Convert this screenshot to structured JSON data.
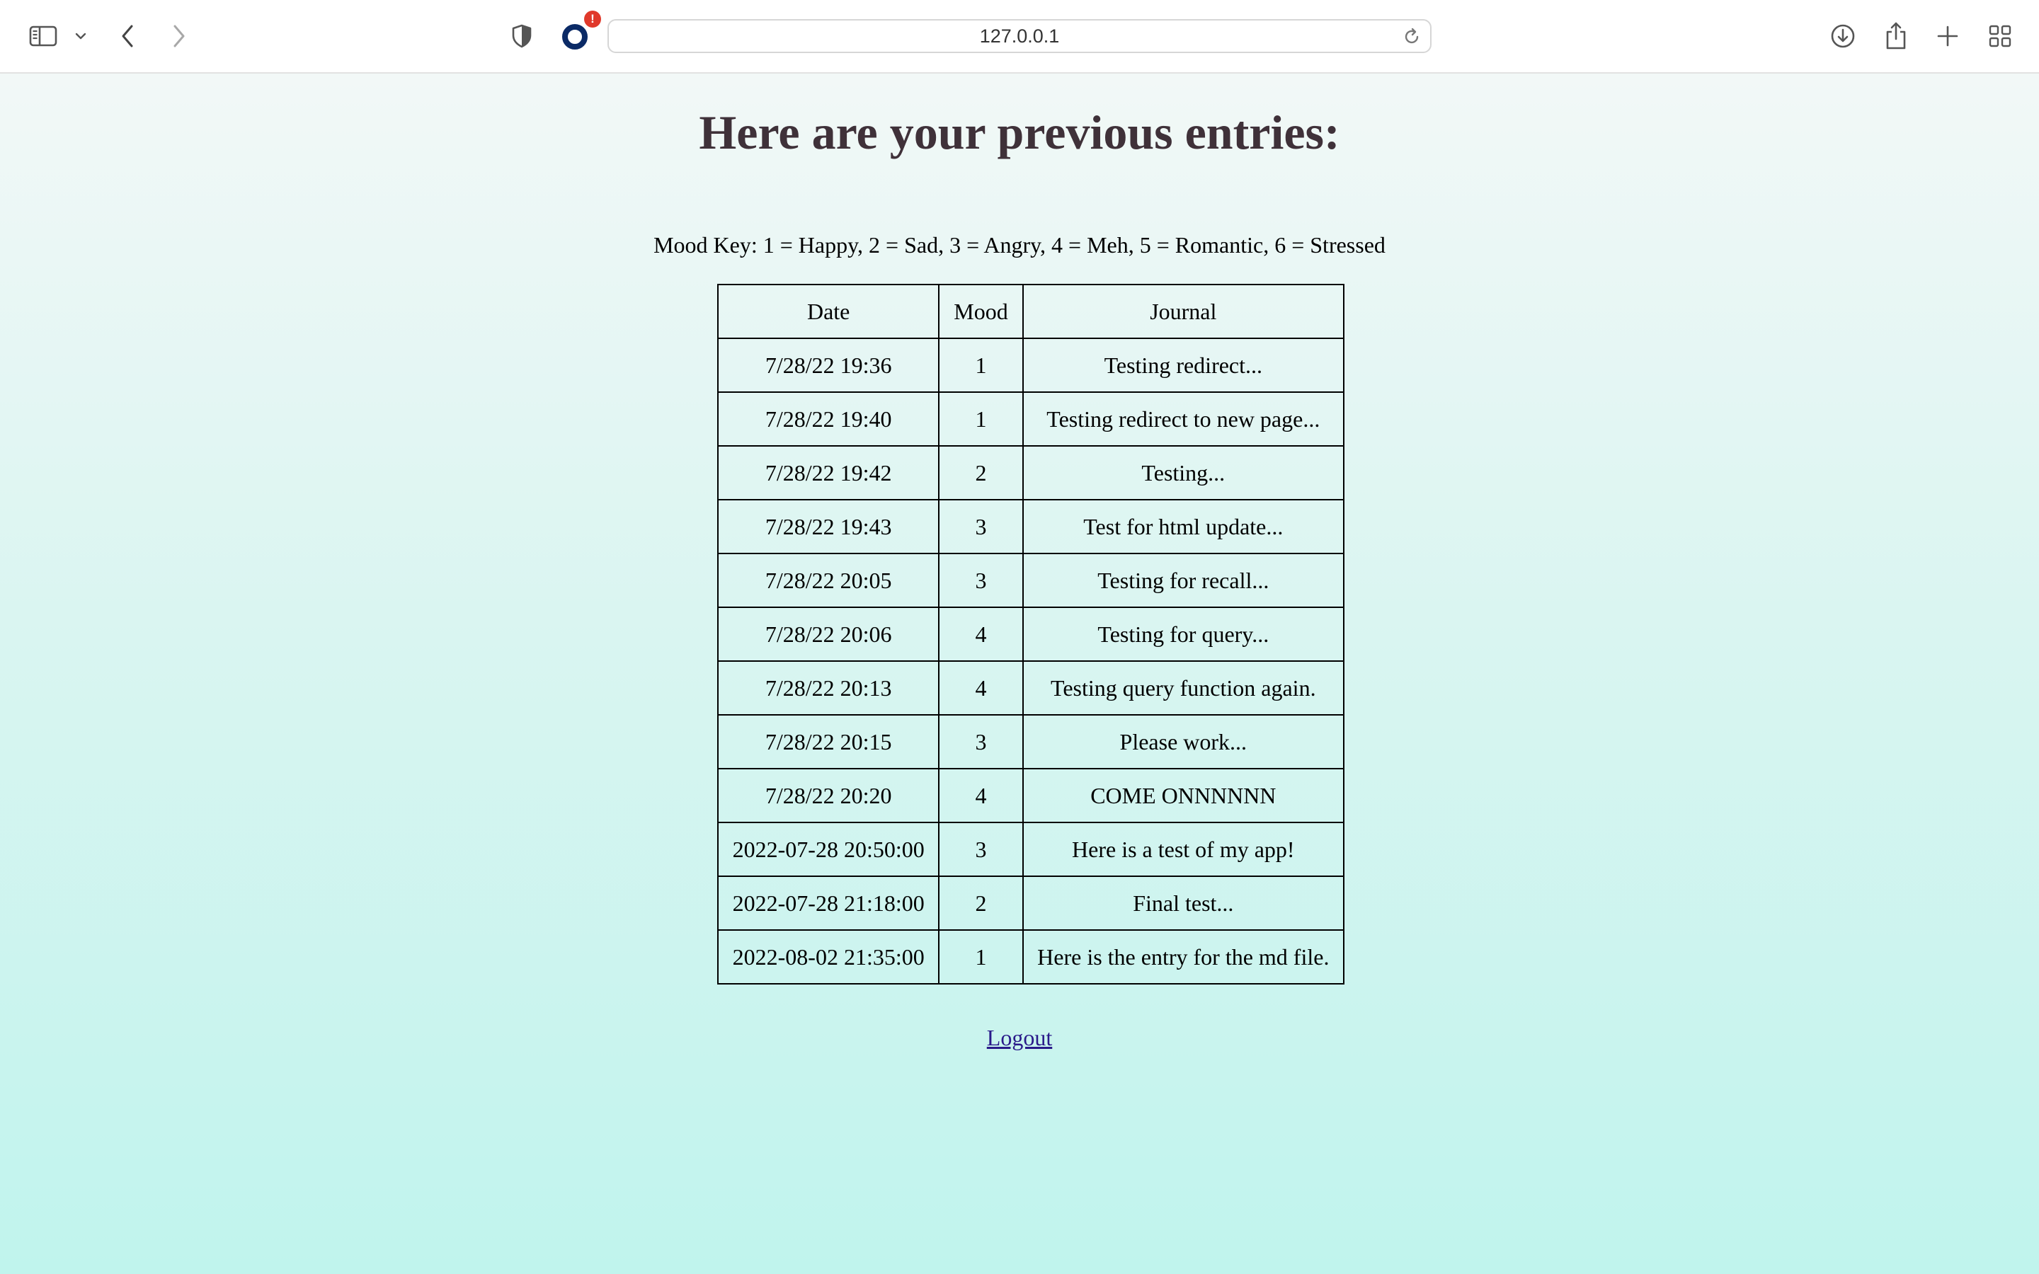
{
  "browser": {
    "url": "127.0.0.1",
    "notification_badge": "!",
    "icons": {
      "sidebar": "sidebar-icon",
      "tab_group_menu": "chevron-down-icon",
      "back": "back-arrow-icon",
      "forward": "forward-arrow-icon",
      "privacy": "shield-icon",
      "extension": "ring-extension-icon",
      "reload": "reload-icon",
      "downloads": "download-icon",
      "share": "share-icon",
      "new_tab": "plus-icon",
      "tab_overview": "grid-icon"
    }
  },
  "page": {
    "heading": "Here are your previous entries:",
    "mood_key": "Mood Key: 1 = Happy, 2 = Sad, 3 = Angry, 4 = Meh, 5 = Romantic, 6 = Stressed",
    "table": {
      "headers": [
        "Date",
        "Mood",
        "Journal"
      ],
      "rows": [
        [
          "7/28/22 19:36",
          "1",
          "Testing redirect..."
        ],
        [
          "7/28/22 19:40",
          "1",
          "Testing redirect to new page..."
        ],
        [
          "7/28/22 19:42",
          "2",
          "Testing..."
        ],
        [
          "7/28/22 19:43",
          "3",
          "Test for html update..."
        ],
        [
          "7/28/22 20:05",
          "3",
          "Testing for recall..."
        ],
        [
          "7/28/22 20:06",
          "4",
          "Testing for query..."
        ],
        [
          "7/28/22 20:13",
          "4",
          "Testing query function again."
        ],
        [
          "7/28/22 20:15",
          "3",
          "Please work..."
        ],
        [
          "7/28/22 20:20",
          "4",
          "COME ONNNNNN"
        ],
        [
          "2022-07-28 20:50:00",
          "3",
          "Here is a test of my app!"
        ],
        [
          "2022-07-28 21:18:00",
          "2",
          "Final test..."
        ],
        [
          "2022-08-02 21:35:00",
          "1",
          "Here is the entry for the md file."
        ]
      ]
    },
    "logout_label": "Logout"
  },
  "colors": {
    "heading": "#3f3139",
    "background_top": "#f2f8f7",
    "background_bottom": "#c0f4ed",
    "link": "#2a1a8a",
    "badge": "#e0392b",
    "extension_ring": "#0b2a66"
  }
}
